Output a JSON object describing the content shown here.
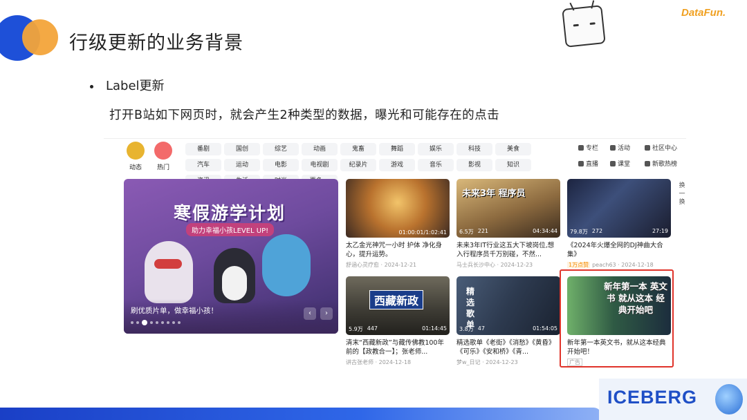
{
  "slide": {
    "title": "行级更新的业务背景",
    "brand": "DataFun.",
    "bullet": "Label更新",
    "description": "打开B站如下网页时，就会产生2种类型的数据，曝光和可能存在的点击",
    "footer_brand": "ICEBERG"
  },
  "bili": {
    "nav": [
      {
        "label": "动态",
        "icon": "dynamic-avatar-icon"
      },
      {
        "label": "热门",
        "icon": "fire-icon"
      }
    ],
    "channels": [
      "番剧",
      "国创",
      "综艺",
      "动画",
      "鬼畜",
      "舞蹈",
      "娱乐",
      "科技",
      "美食",
      "汽车",
      "运动",
      "电影",
      "电视剧",
      "纪录片",
      "游戏",
      "音乐",
      "影视",
      "知识",
      "资讯",
      "生活",
      "时尚",
      "更多 ⌄"
    ],
    "side_links": [
      "专栏",
      "活动",
      "社区中心",
      "直播",
      "课堂",
      "新歌热榜"
    ],
    "refresh": "换一换",
    "banner": {
      "title": "寒假游学计划",
      "subtitle": "助力幸福小孩LEVEL UP!",
      "caption": "刷优质片单，做幸福小孩！",
      "prev": "‹",
      "next": "›"
    },
    "cards": [
      {
        "title": "太乙金光神咒一小时 护体 净化身心，提升运势。",
        "meta": "舒涵心灵疗愈 · 2024-12-21",
        "views": "",
        "comments": "",
        "duration": "01:00:01/1:02:41",
        "thumb_text": ""
      },
      {
        "title": "未来3年IT行业这五大下坡岗位,想入行程序员千万别碰，不然...",
        "meta": "马士兵长沙中心 · 2024-12-23",
        "views": "6.5万",
        "comments": "221",
        "duration": "04:34:44",
        "thumb_text": "未来3年 程序员"
      },
      {
        "title": "《2024年火爆全网的DJ神曲大合集》",
        "meta": "peach63 · 2024-12-18",
        "badge": "1万点赞",
        "views": "79.8万",
        "comments": "272",
        "duration": "27:19",
        "thumb_text": ""
      },
      {
        "title": "清末“西藏新政”与藏传佛教100年前的【政教合一】；张老师...",
        "meta": "讲古张老师 · 2024-12-18",
        "views": "5.9万",
        "comments": "447",
        "duration": "01:14:45",
        "thumb_text": "西藏新政"
      },
      {
        "title": "精选歌单《老街》《消愁》《黄昏》《可乐》《安和桥》《青...",
        "meta": "梦w_日记 · 2024-12-23",
        "views": "3.8万",
        "comments": "47",
        "duration": "01:54:05",
        "thumb_text": "精选歌单"
      },
      {
        "title": "新年第一本英文书，就从这本经典开始吧！",
        "meta": "",
        "ad": "广告",
        "views": "",
        "comments": "",
        "duration": "",
        "thumb_text": "新年第一本 英文书 就从这本 经典开始吧"
      }
    ]
  },
  "colors": {
    "accent_blue": "#1e50d8",
    "accent_orange": "#f3a43a",
    "highlight_red": "#e0332a"
  }
}
